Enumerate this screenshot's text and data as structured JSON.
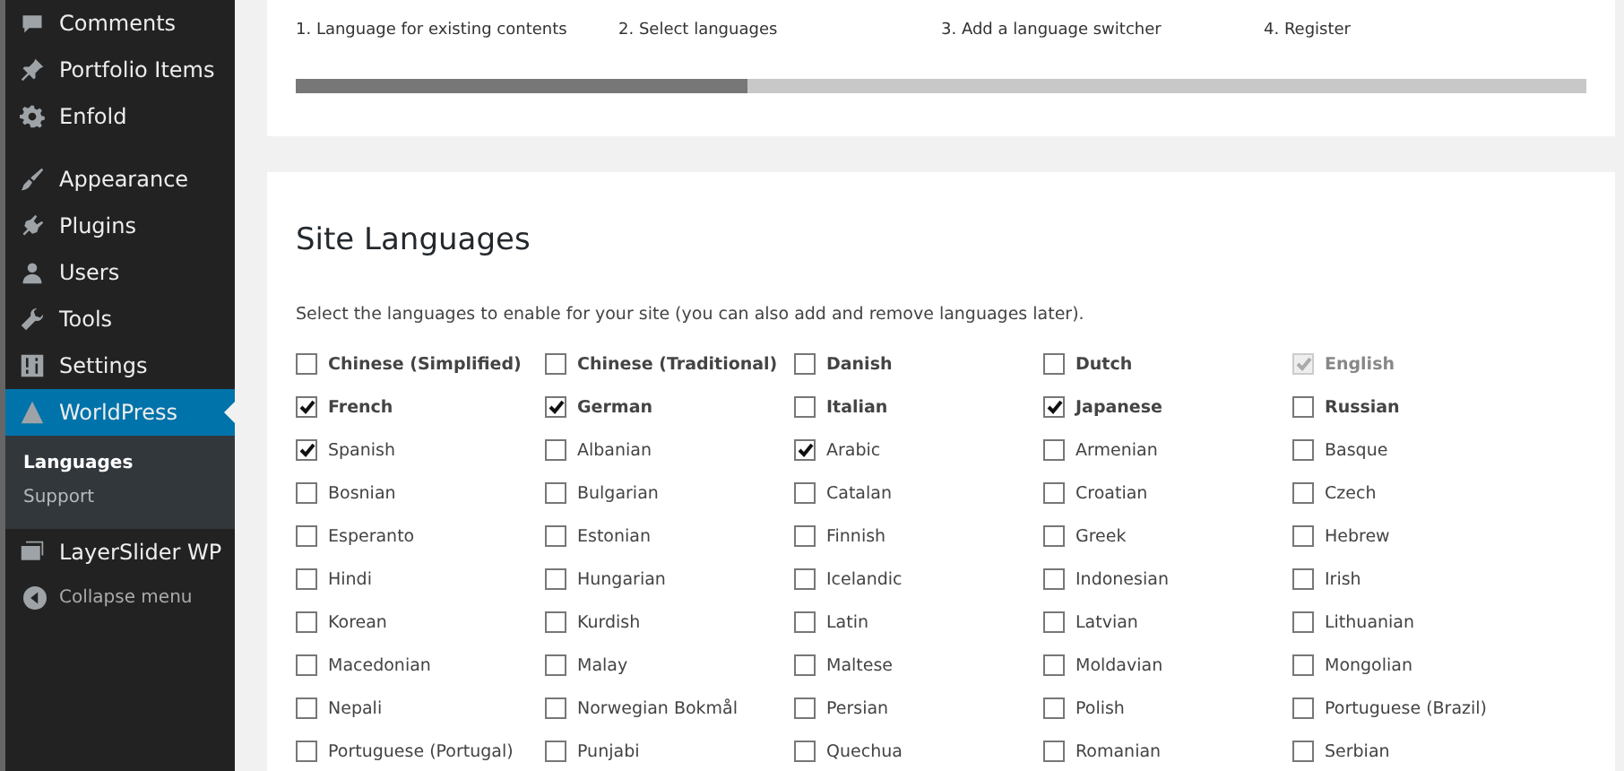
{
  "sidebar": {
    "items": [
      {
        "label": "Comments",
        "kind": "comment",
        "selected": false
      },
      {
        "label": "Portfolio Items",
        "kind": "pin",
        "selected": false
      },
      {
        "label": "Enfold",
        "kind": "gear",
        "selected": false,
        "gap_after": true
      },
      {
        "label": "Appearance",
        "kind": "brush",
        "selected": false
      },
      {
        "label": "Plugins",
        "kind": "plug",
        "selected": false
      },
      {
        "label": "Users",
        "kind": "user",
        "selected": false
      },
      {
        "label": "Tools",
        "kind": "wrench",
        "selected": false
      },
      {
        "label": "Settings",
        "kind": "sliders",
        "selected": false
      },
      {
        "label": "WorldPress",
        "kind": "pyramid",
        "selected": true,
        "children": [
          {
            "label": "Languages",
            "selected": true
          },
          {
            "label": "Support",
            "selected": false
          }
        ]
      },
      {
        "label": "LayerSlider WP",
        "kind": "images",
        "selected": false
      }
    ],
    "collapse": "Collapse menu"
  },
  "wizard": {
    "steps": [
      "1. Language for existing contents",
      "2. Select languages",
      "3. Add a language switcher",
      "4. Register"
    ],
    "level": 0.35
  },
  "site_languages": {
    "title": "Site Languages",
    "description": "Select the languages to enable for your site (you can also add and remove languages later).",
    "languages": [
      {
        "label": "Chinese (Simplified)",
        "checked": false,
        "disabled": false,
        "emphasized": true
      },
      {
        "label": "Chinese (Traditional)",
        "checked": false,
        "disabled": false,
        "emphasized": true
      },
      {
        "label": "Danish",
        "checked": false,
        "disabled": false,
        "emphasized": true
      },
      {
        "label": "Dutch",
        "checked": false,
        "disabled": false,
        "emphasized": true
      },
      {
        "label": "English",
        "checked": true,
        "disabled": true,
        "emphasized": true
      },
      {
        "label": "French",
        "checked": true,
        "disabled": false,
        "emphasized": true
      },
      {
        "label": "German",
        "checked": true,
        "disabled": false,
        "emphasized": true
      },
      {
        "label": "Italian",
        "checked": false,
        "disabled": false,
        "emphasized": true
      },
      {
        "label": "Japanese",
        "checked": true,
        "disabled": false,
        "emphasized": true
      },
      {
        "label": "Russian",
        "checked": false,
        "disabled": false,
        "emphasized": true
      },
      {
        "label": "Spanish",
        "checked": true,
        "disabled": false,
        "emphasized": false
      },
      {
        "label": "Albanian",
        "checked": false,
        "disabled": false,
        "emphasized": false
      },
      {
        "label": "Arabic",
        "checked": true,
        "disabled": false,
        "emphasized": false
      },
      {
        "label": "Armenian",
        "checked": false,
        "disabled": false,
        "emphasized": false
      },
      {
        "label": "Basque",
        "checked": false,
        "disabled": false,
        "emphasized": false
      },
      {
        "label": "Bosnian",
        "checked": false,
        "disabled": false,
        "emphasized": false
      },
      {
        "label": "Bulgarian",
        "checked": false,
        "disabled": false,
        "emphasized": false
      },
      {
        "label": "Catalan",
        "checked": false,
        "disabled": false,
        "emphasized": false
      },
      {
        "label": "Croatian",
        "checked": false,
        "disabled": false,
        "emphasized": false
      },
      {
        "label": "Czech",
        "checked": false,
        "disabled": false,
        "emphasized": false
      },
      {
        "label": "Esperanto",
        "checked": false,
        "disabled": false,
        "emphasized": false
      },
      {
        "label": "Estonian",
        "checked": false,
        "disabled": false,
        "emphasized": false
      },
      {
        "label": "Finnish",
        "checked": false,
        "disabled": false,
        "emphasized": false
      },
      {
        "label": "Greek",
        "checked": false,
        "disabled": false,
        "emphasized": false
      },
      {
        "label": "Hebrew",
        "checked": false,
        "disabled": false,
        "emphasized": false
      },
      {
        "label": "Hindi",
        "checked": false,
        "disabled": false,
        "emphasized": false
      },
      {
        "label": "Hungarian",
        "checked": false,
        "disabled": false,
        "emphasized": false
      },
      {
        "label": "Icelandic",
        "checked": false,
        "disabled": false,
        "emphasized": false
      },
      {
        "label": "Indonesian",
        "checked": false,
        "disabled": false,
        "emphasized": false
      },
      {
        "label": "Irish",
        "checked": false,
        "disabled": false,
        "emphasized": false
      },
      {
        "label": "Korean",
        "checked": false,
        "disabled": false,
        "emphasized": false
      },
      {
        "label": "Kurdish",
        "checked": false,
        "disabled": false,
        "emphasized": false
      },
      {
        "label": "Latin",
        "checked": false,
        "disabled": false,
        "emphasized": false
      },
      {
        "label": "Latvian",
        "checked": false,
        "disabled": false,
        "emphasized": false
      },
      {
        "label": "Lithuanian",
        "checked": false,
        "disabled": false,
        "emphasized": false
      },
      {
        "label": "Macedonian",
        "checked": false,
        "disabled": false,
        "emphasized": false
      },
      {
        "label": "Malay",
        "checked": false,
        "disabled": false,
        "emphasized": false
      },
      {
        "label": "Maltese",
        "checked": false,
        "disabled": false,
        "emphasized": false
      },
      {
        "label": "Moldavian",
        "checked": false,
        "disabled": false,
        "emphasized": false
      },
      {
        "label": "Mongolian",
        "checked": false,
        "disabled": false,
        "emphasized": false
      },
      {
        "label": "Nepali",
        "checked": false,
        "disabled": false,
        "emphasized": false
      },
      {
        "label": "Norwegian Bokmål",
        "checked": false,
        "disabled": false,
        "emphasized": false
      },
      {
        "label": "Persian",
        "checked": false,
        "disabled": false,
        "emphasized": false
      },
      {
        "label": "Polish",
        "checked": false,
        "disabled": false,
        "emphasized": false
      },
      {
        "label": "Portuguese (Brazil)",
        "checked": false,
        "disabled": false,
        "emphasized": false
      },
      {
        "label": "Portuguese (Portugal)",
        "checked": false,
        "disabled": false,
        "emphasized": false
      },
      {
        "label": "Punjabi",
        "checked": false,
        "disabled": false,
        "emphasized": false
      },
      {
        "label": "Quechua",
        "checked": false,
        "disabled": false,
        "emphasized": false
      },
      {
        "label": "Romanian",
        "checked": false,
        "disabled": false,
        "emphasized": false
      },
      {
        "label": "Serbian",
        "checked": false,
        "disabled": false,
        "emphasized": false
      }
    ]
  }
}
